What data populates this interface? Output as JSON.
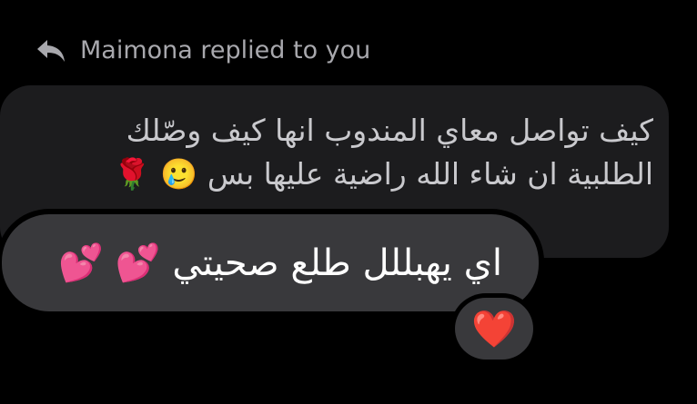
{
  "reply_header": {
    "text": "Maimona replied to you",
    "icon": "reply-arrow-icon"
  },
  "quoted_message": {
    "line1": "كيف تواصل معاي المندوب انها كيف وصّلك",
    "line2": "الطلبية ان شاء الله راضية عليها بس 🥲 🌹"
  },
  "reply_message": {
    "text": "اي يهبللل طلع صحيتي 💕 💕"
  },
  "reaction": {
    "emoji": "❤️"
  },
  "colors": {
    "background": "#000000",
    "quoted_bubble": "#1c1c1e",
    "reply_bubble": "#39393c",
    "header_text": "#a8a8ad",
    "quoted_text": "#c9c9cd",
    "reply_text": "#ffffff"
  }
}
